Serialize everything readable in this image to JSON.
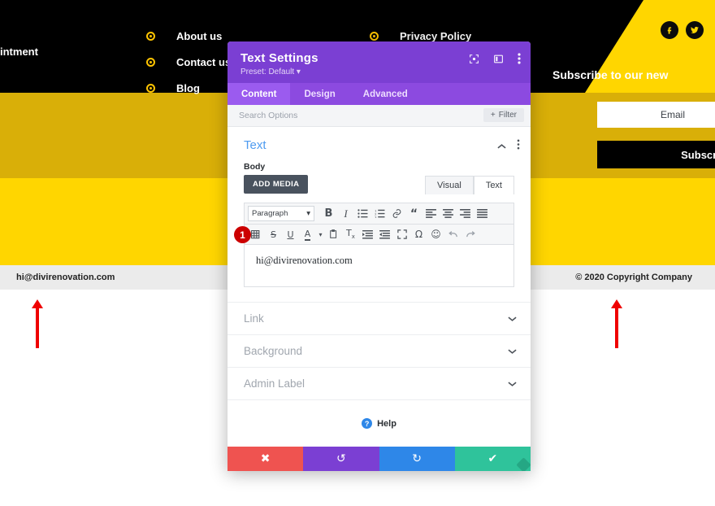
{
  "site": {
    "nav_left_fragment": "intment",
    "nav_column_1": [
      {
        "label": "About us",
        "icon": "bullet-icon"
      },
      {
        "label": "Contact us",
        "icon": "bullet-icon"
      },
      {
        "label": "Blog",
        "icon": "bullet-icon"
      }
    ],
    "nav_column_2": [
      {
        "label": "Privacy Policy",
        "icon": "bullet-icon"
      }
    ],
    "social": [
      {
        "name": "facebook-icon",
        "glyph": "f"
      },
      {
        "name": "twitter-icon",
        "glyph": "✦"
      }
    ],
    "subscribe": {
      "title": "Subscribe to our new",
      "email_placeholder": "Email",
      "button_label": "Subscribe"
    },
    "footer": {
      "left": "hi@divirenovation.com",
      "right": "© 2020 Copyright Company"
    },
    "colors": {
      "yellow": "#FFD600",
      "gold": "#D9AF08",
      "black": "#000000",
      "footer_bg": "#EBEBEB",
      "arrow_red": "#EF0000"
    }
  },
  "annotation": {
    "badge_number": "1"
  },
  "modal": {
    "title": "Text Settings",
    "preset": "Preset: Default ▾",
    "header_icons": [
      {
        "name": "focus-icon"
      },
      {
        "name": "layout-columns-icon"
      },
      {
        "name": "more-vertical-icon"
      }
    ],
    "tabs": [
      {
        "label": "Content",
        "active": true
      },
      {
        "label": "Design",
        "active": false
      },
      {
        "label": "Advanced",
        "active": false
      }
    ],
    "search": {
      "placeholder": "Search Options",
      "filter_label": "Filter",
      "filter_plus": "+"
    },
    "section": {
      "title": "Text",
      "collapse_icon": "chevron-up-icon",
      "menu_icon": "more-vertical-icon"
    },
    "field": {
      "label": "Body",
      "add_media_label": "ADD MEDIA",
      "mode_tabs": [
        {
          "label": "Visual",
          "active": false
        },
        {
          "label": "Text",
          "active": true
        }
      ],
      "paragraph_select": "Paragraph",
      "paragraph_caret": "▾",
      "toolbar_row_1": [
        {
          "name": "bold-icon",
          "glyph": "B"
        },
        {
          "name": "italic-icon",
          "glyph": "I"
        },
        {
          "name": "bullet-list-icon",
          "glyph": "☰"
        },
        {
          "name": "numbered-list-icon",
          "glyph": "☷"
        },
        {
          "name": "link-icon",
          "glyph": "⚭"
        },
        {
          "name": "blockquote-icon",
          "glyph": "“"
        },
        {
          "name": "align-left-icon",
          "glyph": "≡"
        },
        {
          "name": "align-center-icon",
          "glyph": "≡"
        },
        {
          "name": "align-right-icon",
          "glyph": "≡"
        },
        {
          "name": "align-justify-icon",
          "glyph": "≣"
        }
      ],
      "toolbar_row_2": [
        {
          "name": "table-icon",
          "glyph": "⊞"
        },
        {
          "name": "strikethrough-icon",
          "glyph": "S"
        },
        {
          "name": "underline-icon",
          "glyph": "U"
        },
        {
          "name": "text-color-icon",
          "glyph": "A"
        },
        {
          "name": "paste-as-text-icon",
          "glyph": "▤"
        },
        {
          "name": "clear-formatting-icon",
          "glyph": "T"
        },
        {
          "name": "outdent-icon",
          "glyph": "◧"
        },
        {
          "name": "indent-icon",
          "glyph": "◨"
        },
        {
          "name": "fullscreen-icon",
          "glyph": "⛶"
        },
        {
          "name": "special-character-icon",
          "glyph": "Ω"
        },
        {
          "name": "emoji-icon",
          "glyph": "☺"
        },
        {
          "name": "undo-icon",
          "glyph": "↩"
        },
        {
          "name": "redo-icon",
          "glyph": "↪"
        }
      ],
      "content_value": "hi@divirenovation.com"
    },
    "accordions": [
      {
        "label": "Link",
        "icon": "chevron-down-icon"
      },
      {
        "label": "Background",
        "icon": "chevron-down-icon"
      },
      {
        "label": "Admin Label",
        "icon": "chevron-down-icon"
      }
    ],
    "help_label": "Help",
    "help_icon_glyph": "?",
    "actions": [
      {
        "name": "cancel-button",
        "glyph": "✖",
        "color": "#EF5350"
      },
      {
        "name": "undo-button",
        "glyph": "↺",
        "color": "#7B3FD3"
      },
      {
        "name": "redo-button",
        "glyph": "↻",
        "color": "#2E87E8"
      },
      {
        "name": "save-button",
        "glyph": "✔",
        "color": "#2FC39B"
      }
    ]
  }
}
